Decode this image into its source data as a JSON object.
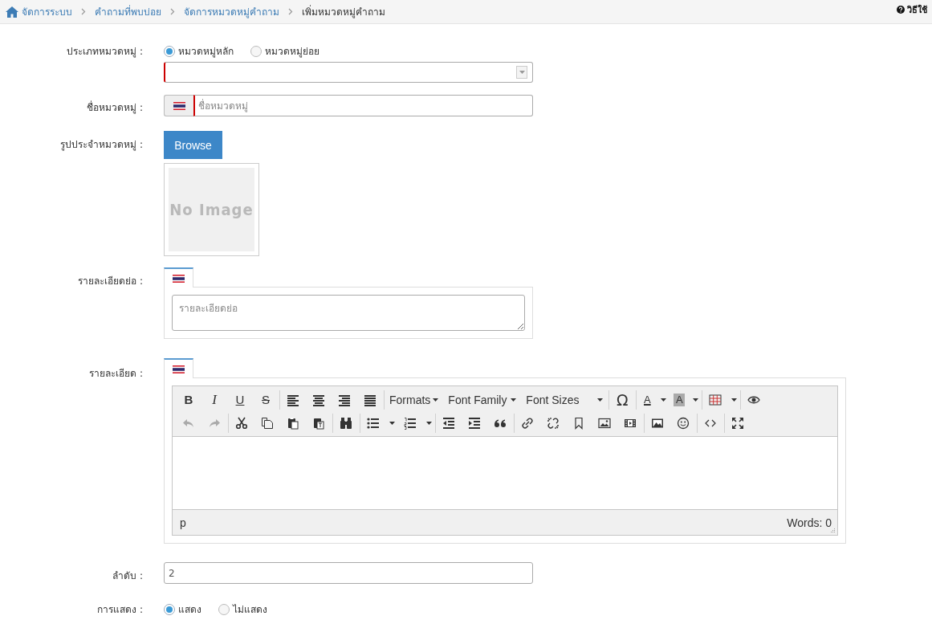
{
  "breadcrumb": [
    {
      "label": "จัดการระบบ",
      "current": false
    },
    {
      "label": "คำถามที่พบบ่อย",
      "current": false
    },
    {
      "label": "จัดการหมวดหมู่คำถาม",
      "current": false
    },
    {
      "label": "เพิ่มหมวดหมู่คำถาม",
      "current": true
    }
  ],
  "help": {
    "label": "วิธีใช้"
  },
  "category_type": {
    "label": "ประเภทหมวดหมู่ :",
    "options": [
      {
        "label": "หมวดหมู่หลัก",
        "selected": true
      },
      {
        "label": "หมวดหมู่ย่อย",
        "selected": false
      }
    ]
  },
  "parent_select": {
    "required": true
  },
  "name": {
    "label": "ชื่อหมวดหมู่ :",
    "placeholder": "ชื่อหมวดหมู่",
    "required": true
  },
  "image": {
    "label": "รูปประจำหมวดหมู่ :",
    "button": "Browse",
    "preview_text": "No Image"
  },
  "summary": {
    "label": "รายละเอียดย่อ :",
    "placeholder": "รายละเอียดย่อ"
  },
  "detail": {
    "label": "รายละเอียด :",
    "editor": {
      "format_buttons": [
        "B",
        "I",
        "U",
        "S"
      ],
      "menus": [
        "Formats",
        "Font Family",
        "Font Sizes"
      ],
      "symbol": "Ω",
      "color_buttons": [
        "A",
        "A"
      ],
      "undo_disabled": true,
      "redo_disabled": true,
      "path": "p",
      "word_count": "Words: 0"
    }
  },
  "order": {
    "label": "ลำดับ :",
    "value": "2"
  },
  "display": {
    "label": "การแสดง :",
    "options": [
      {
        "label": "แสดง",
        "selected": true
      },
      {
        "label": "ไม่แสดง",
        "selected": false
      }
    ]
  }
}
